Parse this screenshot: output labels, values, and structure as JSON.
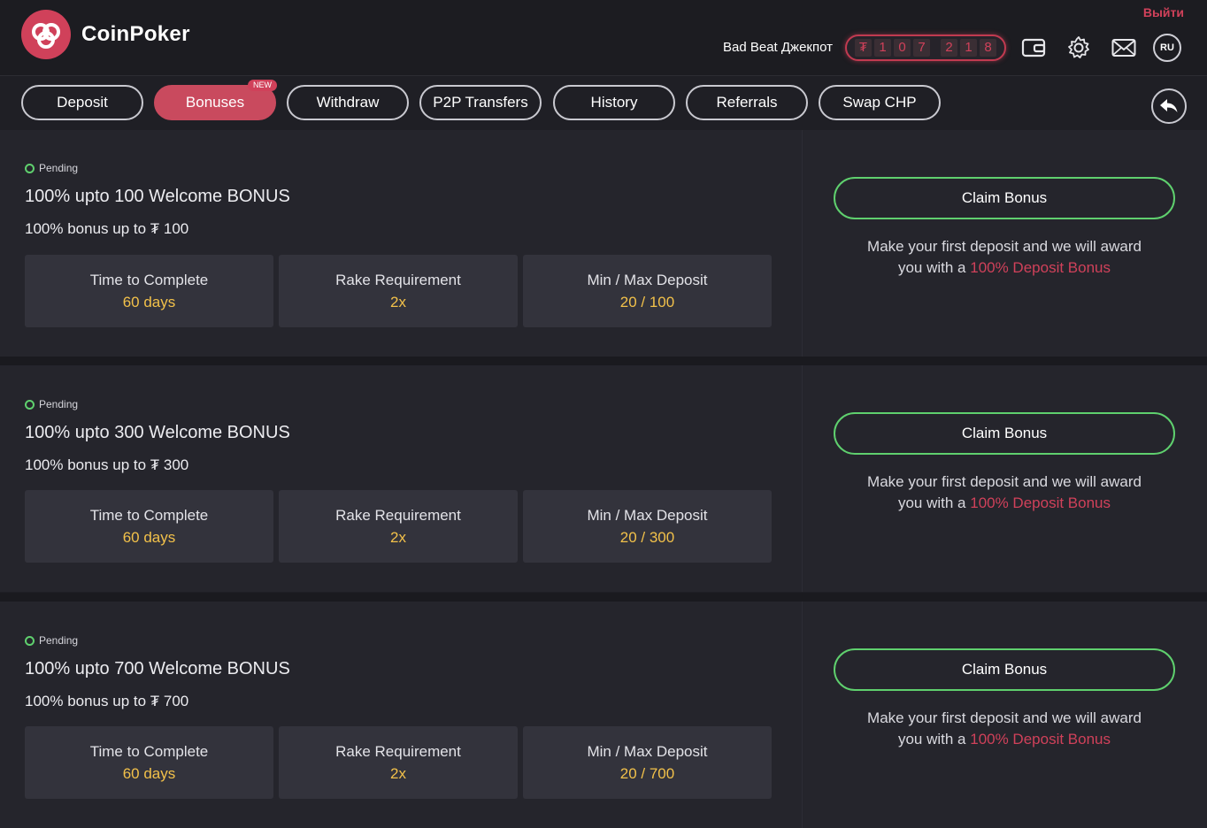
{
  "header": {
    "brand": "CoinPoker",
    "logout": "Выйти",
    "jackpot_label": "Bad Beat Джекпот",
    "jackpot_digits": [
      "₮",
      "1",
      "0",
      "7",
      "2",
      "1",
      "8"
    ],
    "language": "RU",
    "icons": [
      "wallet-icon",
      "gear-icon",
      "mail-icon"
    ]
  },
  "nav": {
    "tabs": [
      {
        "label": "Deposit"
      },
      {
        "label": "Bonuses",
        "badge": "NEW",
        "active": true
      },
      {
        "label": "Withdraw"
      },
      {
        "label": "P2P Transfers"
      },
      {
        "label": "History"
      },
      {
        "label": "Referrals"
      },
      {
        "label": "Swap CHP"
      }
    ]
  },
  "bonuses": [
    {
      "status": "Pending",
      "title": "100% upto 100 Welcome BONUS",
      "subtitle": "100% bonus up to ₮ 100",
      "stats": [
        {
          "label": "Time to Complete",
          "value": "60 days"
        },
        {
          "label": "Rake Requirement",
          "value": "2x"
        },
        {
          "label": "Min / Max Deposit",
          "value": "20 / 100"
        }
      ],
      "claim_label": "Claim Bonus",
      "promo_line1": "Make your first deposit and we will award",
      "promo_line2": "you with a ",
      "promo_highlight": "100% Deposit Bonus"
    },
    {
      "status": "Pending",
      "title": "100% upto 300 Welcome BONUS",
      "subtitle": "100% bonus up to ₮ 300",
      "stats": [
        {
          "label": "Time to Complete",
          "value": "60 days"
        },
        {
          "label": "Rake Requirement",
          "value": "2x"
        },
        {
          "label": "Min / Max Deposit",
          "value": "20 / 300"
        }
      ],
      "claim_label": "Claim Bonus",
      "promo_line1": "Make your first deposit and we will award",
      "promo_line2": "you with a ",
      "promo_highlight": "100% Deposit Bonus"
    },
    {
      "status": "Pending",
      "title": "100% upto 700 Welcome BONUS",
      "subtitle": "100% bonus up to ₮ 700",
      "stats": [
        {
          "label": "Time to Complete",
          "value": "60 days"
        },
        {
          "label": "Rake Requirement",
          "value": "2x"
        },
        {
          "label": "Min / Max Deposit",
          "value": "20 / 700"
        }
      ],
      "claim_label": "Claim Bonus",
      "promo_line1": "Make your first deposit and we will award",
      "promo_line2": "you with a ",
      "promo_highlight": "100% Deposit Bonus"
    }
  ],
  "colors": {
    "accent": "#d0415a",
    "success": "#5fd06e",
    "value": "#f2c14a",
    "background": "#1f1f25"
  }
}
